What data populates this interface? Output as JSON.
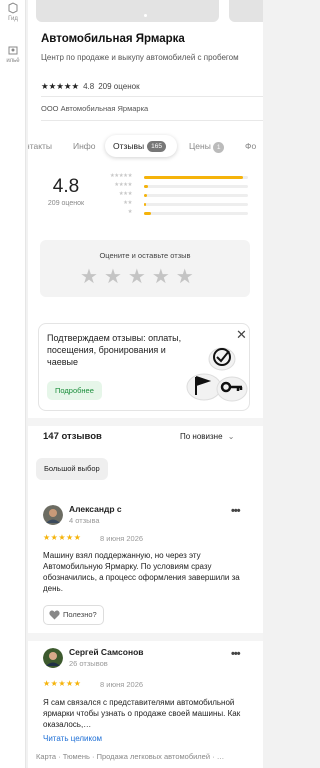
{
  "rail": {
    "items": [
      {
        "label": "Гид",
        "icon": "guide-icon"
      },
      {
        "label": "ильё",
        "icon": "housing-icon"
      }
    ]
  },
  "org": {
    "title": "Автомобильная Ярмарка",
    "subtitle": "Центр по продаже и выкупу автомобилей с пробегом",
    "rating_stars": "★★★★★",
    "rating": "4.8",
    "ratings_count": "209 оценок",
    "company": "ООО Автомобильная Ярмарка"
  },
  "tabs": [
    {
      "label": "нтакты"
    },
    {
      "label": "Инфо"
    },
    {
      "label": "Отзывы",
      "count": "165",
      "active": true
    },
    {
      "label": "Цены",
      "count": "1"
    },
    {
      "label": "Фо"
    }
  ],
  "rating_summary": {
    "value": "4.8",
    "count_label": "209 оценок",
    "distribution": [
      {
        "stars": "★★★★★",
        "fraction": 0.95
      },
      {
        "stars": "★★★★",
        "fraction": 0.04
      },
      {
        "stars": "★★★",
        "fraction": 0.03
      },
      {
        "stars": "★★",
        "fraction": 0.02
      },
      {
        "stars": "★",
        "fraction": 0.07
      }
    ]
  },
  "rate_prompt": {
    "label": "Оцените и оставьте отзыв",
    "star_glyph": "★"
  },
  "promo": {
    "text": "Подтверждаем отзывы: оплаты, посещения, бронирования и чаевые",
    "button": "Подробнее",
    "close_glyph": "✕"
  },
  "reviews_header": {
    "count_label": "147 отзывов",
    "sort_label": "По новизне",
    "sort_glyph": "⌄"
  },
  "filter_chip": "Большой выбор",
  "reviews": [
    {
      "author": "Александр с",
      "sub": "4 отзыва",
      "stars": "★★★★★",
      "date": "8 июня 2026",
      "text": "Машину взял поддержанную, но через эту Автомобильную Ярмарку. По условиям сразу обозначились, а процесс оформления завершили за день.",
      "useful": "Полезно?",
      "more": "•••"
    },
    {
      "author": "Сергей Самсонов",
      "sub": "26 отзывов",
      "stars": "★★★★★",
      "date": "8 июня 2026",
      "text": "Я сам связался с представителями автомобильной ярмарки чтобы узнать о продаже своей машины. Как оказалось,…",
      "read_more": "Читать целиком",
      "more": "•••"
    }
  ],
  "breadcrumbs": "Карта · Тюмень · Продажа легковых автомобилей · …",
  "colors": {
    "accent_star": "#f5b30a",
    "promo_green": "#1b8e3b",
    "link_blue": "#1e6fd6"
  }
}
